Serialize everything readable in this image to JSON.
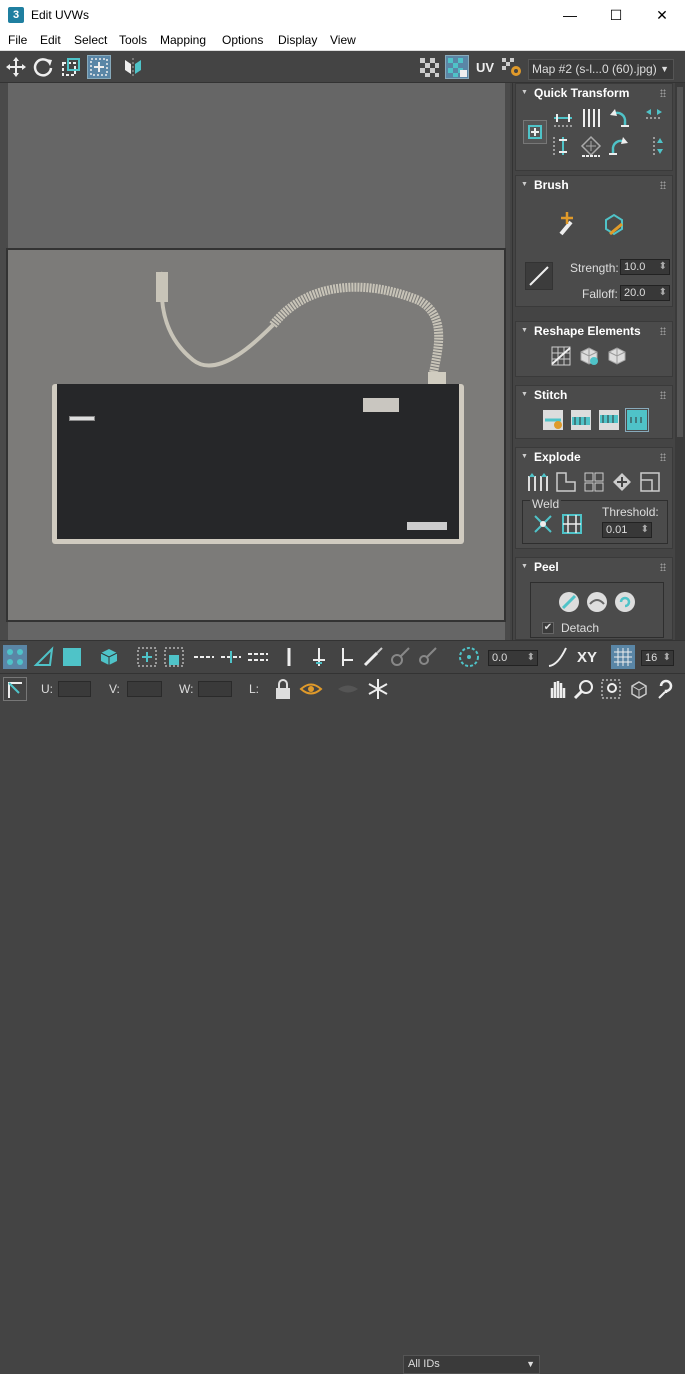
{
  "window": {
    "title": "Edit UVWs",
    "app_icon_text": "3",
    "minimize": "—",
    "maximize": "☐",
    "close": "✕"
  },
  "menu": [
    "File",
    "Edit",
    "Select",
    "Tools",
    "Mapping",
    "Options",
    "Display",
    "View"
  ],
  "toolbar": {
    "uv_label": "UV",
    "map_dropdown": "Map #2 (s-l...0 (60).jpg)"
  },
  "panel": {
    "quick_transform": {
      "title": "Quick Transform"
    },
    "brush": {
      "title": "Brush",
      "strength_label": "Strength:",
      "strength_value": "10.0",
      "falloff_label": "Falloff:",
      "falloff_value": "20.0"
    },
    "reshape": {
      "title": "Reshape Elements"
    },
    "stitch": {
      "title": "Stitch"
    },
    "explode": {
      "title": "Explode",
      "weld_label": "Weld",
      "threshold_label": "Threshold:",
      "threshold_value": "0.01"
    },
    "peel": {
      "title": "Peel",
      "detach_label": "Detach",
      "detach_checked": "✔"
    }
  },
  "bottom": {
    "rotate_value": "0.0",
    "xy_label": "XY",
    "grid_value": "16",
    "u_label": "U:",
    "v_label": "V:",
    "w_label": "W:",
    "l_label": "L:",
    "ids_dropdown": "All IDs"
  },
  "colors": {
    "accent": "#4fc3c8",
    "active_button": "#5a86a6",
    "panel_bg": "#4b4b4b"
  }
}
